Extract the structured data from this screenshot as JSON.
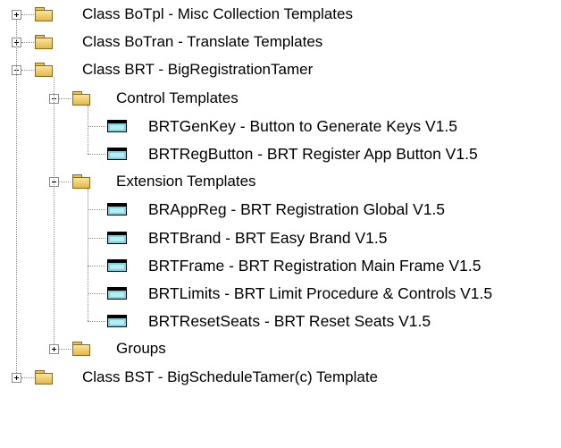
{
  "tree": {
    "nodes": [
      {
        "level": 1,
        "kind": "folder",
        "expander": "plus",
        "label": "Class BoTpl - Misc Collection Templates"
      },
      {
        "level": 1,
        "kind": "folder",
        "expander": "plus",
        "label": "Class BoTran -  Translate Templates"
      },
      {
        "level": 1,
        "kind": "folder",
        "expander": "minus",
        "label": "Class BRT - BigRegistrationTamer"
      },
      {
        "level": 2,
        "kind": "folder",
        "expander": "minus",
        "label": "Control Templates"
      },
      {
        "level": 3,
        "kind": "template",
        "expander": "none",
        "label": "BRTGenKey - Button to Generate Keys V1.5"
      },
      {
        "level": 3,
        "kind": "template",
        "expander": "none",
        "label": "BRTRegButton - BRT Register App Button V1.5"
      },
      {
        "level": 2,
        "kind": "folder",
        "expander": "minus",
        "label": "Extension Templates"
      },
      {
        "level": 3,
        "kind": "template",
        "expander": "none",
        "label": "BRAppReg - BRT Registration Global V1.5"
      },
      {
        "level": 3,
        "kind": "template",
        "expander": "none",
        "label": "BRTBrand - BRT Easy Brand V1.5"
      },
      {
        "level": 3,
        "kind": "template",
        "expander": "none",
        "label": "BRTFrame - BRT Registration Main Frame V1.5"
      },
      {
        "level": 3,
        "kind": "template",
        "expander": "none",
        "label": "BRTLimits - BRT Limit Procedure & Controls V1.5"
      },
      {
        "level": 3,
        "kind": "template",
        "expander": "none",
        "label": "BRTResetSeats - BRT Reset Seats V1.5"
      },
      {
        "level": 2,
        "kind": "folder",
        "expander": "plus",
        "label": "Groups"
      },
      {
        "level": 1,
        "kind": "folder",
        "expander": "plus",
        "label": "Class BST - BigScheduleTamer(c) Template"
      }
    ]
  },
  "colors": {
    "folder_fill": "#f0cf6a",
    "template_fill": "#7ad3de",
    "guide_line": "#8a8a8a"
  }
}
